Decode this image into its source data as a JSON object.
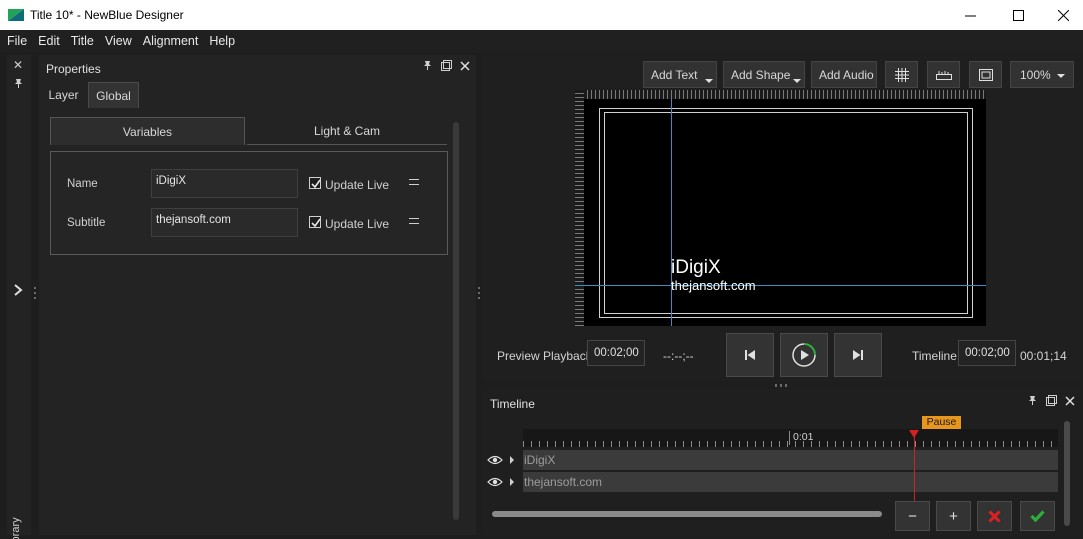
{
  "window": {
    "title": "Title 10* - NewBlue Designer",
    "icon": "newblue-logo",
    "controls": [
      "minimize-icon",
      "maximize-icon",
      "close-icon"
    ]
  },
  "menu": [
    "File",
    "Edit",
    "Title",
    "View",
    "Alignment",
    "Help"
  ],
  "left_strip": {
    "library_label": "Library"
  },
  "properties": {
    "title": "Properties",
    "tabs": [
      "Layer",
      "Global"
    ],
    "active_tab": "Global",
    "subtabs": [
      "Variables",
      "Light & Cam"
    ],
    "active_subtab": "Variables",
    "variables": [
      {
        "label": "Name",
        "value": "iDigiX",
        "update_live_label": "Update Live",
        "update_live": true
      },
      {
        "label": "Subtitle",
        "value": "thejansoft.com",
        "update_live_label": "Update Live",
        "update_live": true
      }
    ]
  },
  "toolbar": {
    "add_text": "Add Text",
    "add_shape": "Add Shape",
    "add_audio": "Add Audio",
    "zoom": "100%"
  },
  "canvas": {
    "title_text": "iDigiX",
    "subtitle_text": "thejansoft.com",
    "background": "#000000",
    "guide_color": "#3a8ec4"
  },
  "playback": {
    "preview_label": "Preview Playback",
    "preview_time": "00:02;00",
    "preview_marker": "--:--;--",
    "timeline_label": "Timeline",
    "timeline_time": "00:02;00",
    "duration": "00:01;14"
  },
  "timeline": {
    "title": "Timeline",
    "ruler_mark": "0:01",
    "pause_badge": "Pause",
    "tracks": [
      "iDigiX",
      "thejansoft.com"
    ],
    "buttons": {
      "minus": "−",
      "plus": "+"
    },
    "colors": {
      "playhead": "#d42020",
      "pause": "#e8971e",
      "cancel": "#e02020",
      "confirm": "#2fae3a"
    }
  }
}
